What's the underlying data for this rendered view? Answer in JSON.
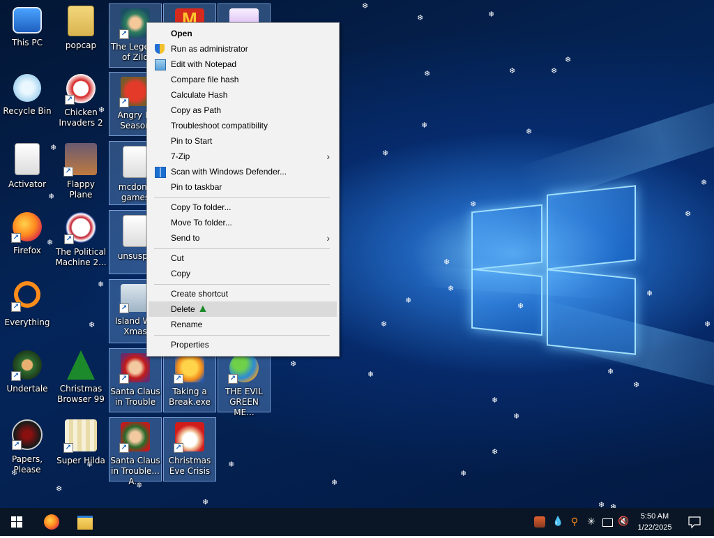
{
  "desktop": {
    "icons": [
      {
        "label": "This PC"
      },
      {
        "label": "popcap"
      },
      {
        "label": "The Legend of Zild"
      },
      {
        "label": ""
      },
      {
        "label": ""
      },
      {
        "label": "Recycle Bin"
      },
      {
        "label": "Chicken Invaders 2"
      },
      {
        "label": "Angry Bi Season"
      },
      {
        "label": "Activator"
      },
      {
        "label": "Flappy Plane"
      },
      {
        "label": "mcdona games"
      },
      {
        "label": "Firefox"
      },
      {
        "label": "The Political Machine 2..."
      },
      {
        "label": "unsuspe"
      },
      {
        "label": "Everything"
      },
      {
        "label": "Island Wa Xmas"
      },
      {
        "label": "Undertale"
      },
      {
        "label": "Christmas Browser 99"
      },
      {
        "label": "Santa Claus in Trouble"
      },
      {
        "label": "Taking a Break.exe"
      },
      {
        "label": "THE EVIL GREEN ME..."
      },
      {
        "label": "Papers, Please"
      },
      {
        "label": "Super Hilda"
      },
      {
        "label": "Santa Claus in Trouble... A..."
      },
      {
        "label": "Christmas Eve Crisis"
      }
    ]
  },
  "context_menu": {
    "items": [
      {
        "label": "Open",
        "bold": true
      },
      {
        "label": "Run as administrator",
        "icon": "shield-icon"
      },
      {
        "label": "Edit with Notepad",
        "icon": "notepad-icon"
      },
      {
        "label": "Compare file hash"
      },
      {
        "label": "Calculate Hash"
      },
      {
        "label": "Copy as Path"
      },
      {
        "label": "Troubleshoot compatibility"
      },
      {
        "label": "Pin to Start"
      },
      {
        "label": "7-Zip",
        "submenu": true
      },
      {
        "label": "Scan with Windows Defender...",
        "icon": "defender-icon"
      },
      {
        "label": "Pin to taskbar"
      },
      {
        "label": "Copy To folder..."
      },
      {
        "label": "Move To folder..."
      },
      {
        "label": "Send to",
        "submenu": true
      },
      {
        "label": "Cut"
      },
      {
        "label": "Copy"
      },
      {
        "label": "Create shortcut"
      },
      {
        "label": "Delete",
        "hovered": true
      },
      {
        "label": "Rename"
      },
      {
        "label": "Properties"
      }
    ],
    "submenu_arrow": "›"
  },
  "taskbar": {
    "start_icon": "windows-start-icon",
    "pinned": [
      "firefox-icon",
      "file-explorer-icon"
    ],
    "tray_icons": [
      "app-tray-icon",
      "drop-icon",
      "search-tray-icon",
      "snowflake-tray-icon",
      "network-icon",
      "volume-muted-icon"
    ],
    "clock_time": "5:50 AM",
    "clock_date": "1/22/2025",
    "notification_icon": "action-center-icon"
  },
  "colors": {
    "menu_bg": "#f2f2f2",
    "menu_hover": "#dadada",
    "taskbar_bg": "#0a1625",
    "accent": "#0078d7"
  }
}
